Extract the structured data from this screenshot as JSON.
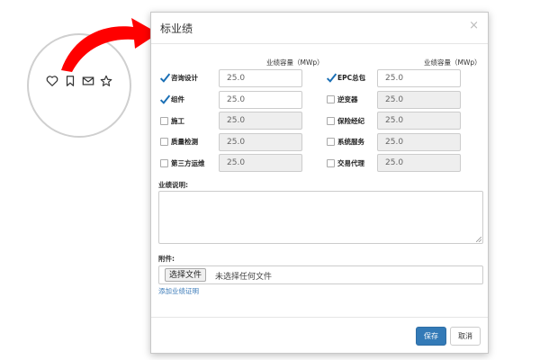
{
  "toolbar_icons": [
    "heart-icon",
    "bookmark-icon",
    "mail-icon",
    "star-icon"
  ],
  "modal": {
    "title": "标业绩",
    "close": "×",
    "capacity_header": "业绩容量（MWp）",
    "left_items": [
      {
        "label": "咨询设计",
        "value": "25.0",
        "checked": true
      },
      {
        "label": "组件",
        "value": "25.0",
        "checked": true
      },
      {
        "label": "施工",
        "value": "25.0",
        "checked": false
      },
      {
        "label": "质量检测",
        "value": "25.0",
        "checked": false
      },
      {
        "label": "第三方运维",
        "value": "25.0",
        "checked": false
      }
    ],
    "right_items": [
      {
        "label": "EPC总包",
        "value": "25.0",
        "checked": true
      },
      {
        "label": "逆变器",
        "value": "25.0",
        "checked": false
      },
      {
        "label": "保险经纪",
        "value": "25.0",
        "checked": false
      },
      {
        "label": "系统服务",
        "value": "25.0",
        "checked": false
      },
      {
        "label": "交易代理",
        "value": "25.0",
        "checked": false
      }
    ],
    "description_label": "业绩说明:",
    "attachment_label": "附件:",
    "file_button": "选择文件",
    "file_status": "未选择任何文件",
    "add_link": "添加业绩证明",
    "save": "保存",
    "cancel": "取消"
  },
  "colors": {
    "accent": "#337ab7",
    "arrow": "#ff0000",
    "check": "#1a6fb5"
  }
}
